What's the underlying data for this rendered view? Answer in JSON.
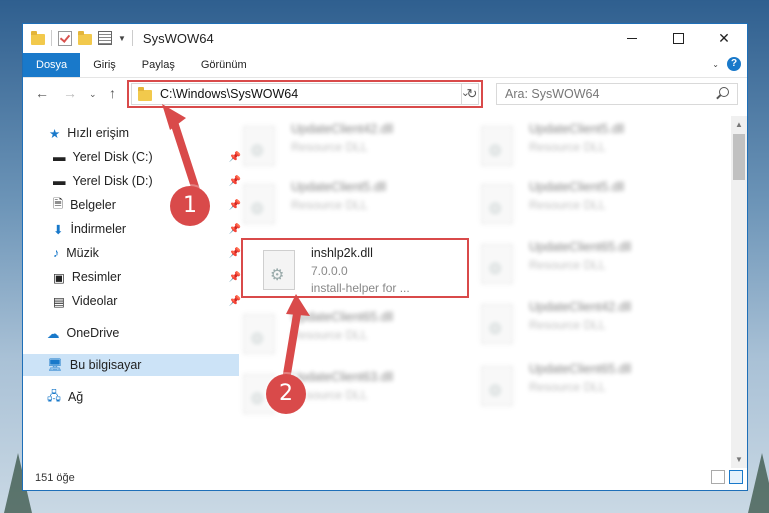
{
  "window": {
    "title": "SysWOW64"
  },
  "ribbon": {
    "tabs": [
      "Dosya",
      "Giriş",
      "Paylaş",
      "Görünüm"
    ]
  },
  "nav": {
    "address": "C:\\Windows\\SysWOW64",
    "search_placeholder": "Ara: SysWOW64"
  },
  "sidebar": {
    "quick_access": "Hızlı erişim",
    "items": [
      "Yerel Disk (C:)",
      "Yerel Disk (D:)",
      "Belgeler",
      "İndirmeler",
      "Müzik",
      "Resimler",
      "Videolar"
    ],
    "onedrive": "OneDrive",
    "this_pc": "Bu bilgisayar",
    "network": "Ağ"
  },
  "files": {
    "left": [
      {
        "name": "UpdateClient42.dll",
        "sub": "Resource DLL"
      },
      {
        "name": "UpdateClient5.dll",
        "sub": "Resource DLL"
      },
      {
        "name": "inshlp2k.dll",
        "sub": "7.0.0.0",
        "sub2": "install-helper for ..."
      },
      {
        "name": "UpdateClient65.dll",
        "sub": "Resource DLL"
      },
      {
        "name": "UpdateClient63.dll",
        "sub": "Resource DLL"
      }
    ],
    "right": [
      {
        "name": "UpdateClient5.dll",
        "sub": "Resource DLL"
      },
      {
        "name": "UpdateClient5.dll",
        "sub": "Resource DLL"
      },
      {
        "name": "UpdateClient65.dll",
        "sub": "Resource DLL"
      },
      {
        "name": "UpdateClient42.dll",
        "sub": "Resource DLL"
      },
      {
        "name": "UpdateClient65.dll",
        "sub": "Resource DLL"
      }
    ]
  },
  "status": {
    "count": "151 öğe"
  },
  "annotations": {
    "badge1": "1",
    "badge2": "2"
  }
}
